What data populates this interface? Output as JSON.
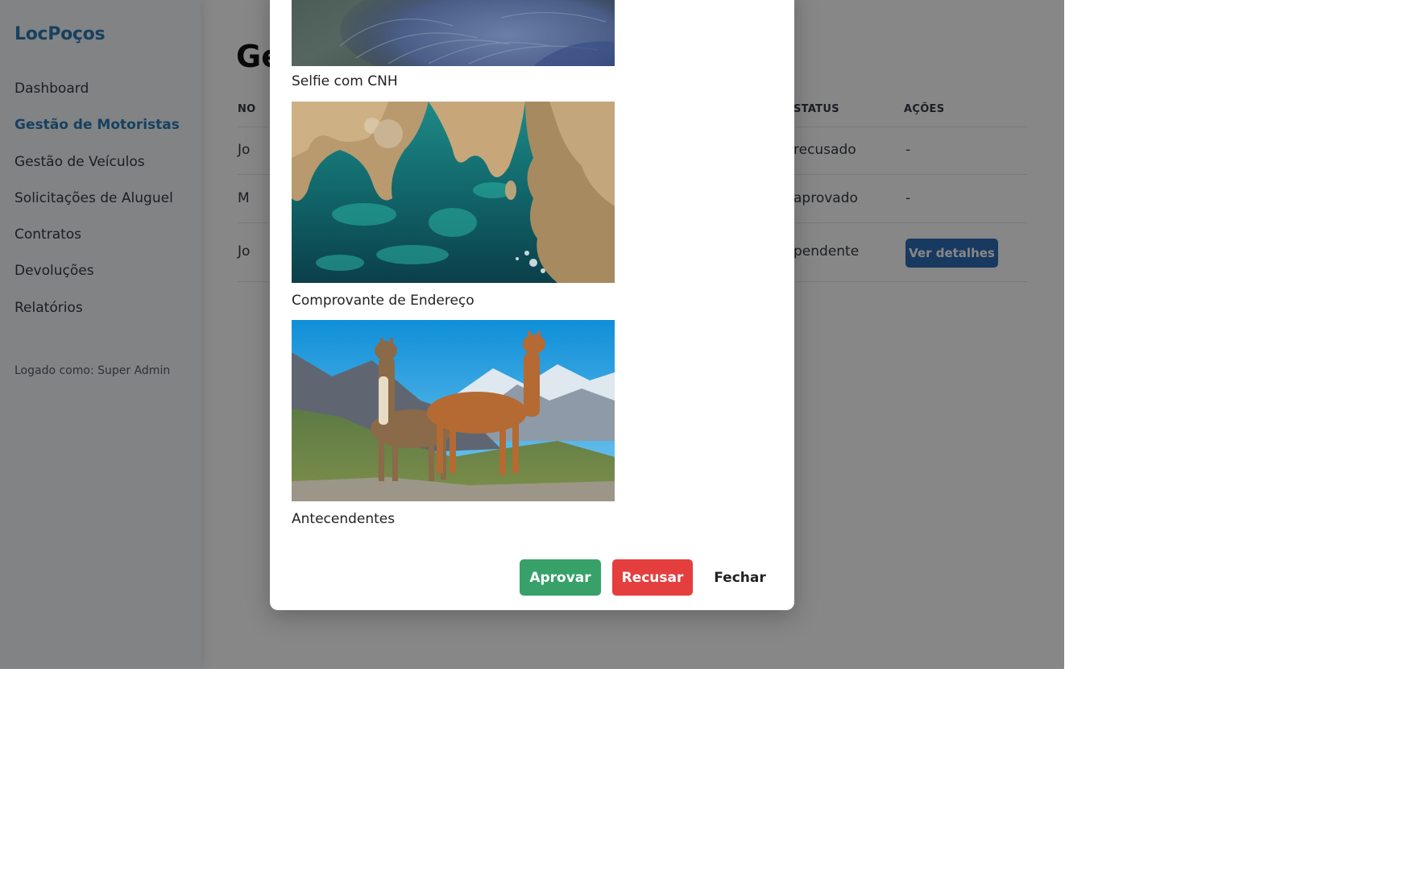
{
  "sidebar": {
    "brand": "LocPoços",
    "items": [
      {
        "label": "Dashboard"
      },
      {
        "label": "Gestão de Motoristas"
      },
      {
        "label": "Gestão de Veículos"
      },
      {
        "label": "Solicitações de Aluguel"
      },
      {
        "label": "Contratos"
      },
      {
        "label": "Devoluções"
      },
      {
        "label": "Relatórios"
      }
    ],
    "active_index": 1,
    "logged_in": "Logado como: Super Admin"
  },
  "main": {
    "title": "Ge",
    "table": {
      "headers": {
        "name": "NO",
        "status": "STATUS",
        "actions": "AÇÕES"
      },
      "rows": [
        {
          "name": "Jo",
          "status": "recusado",
          "action": "-"
        },
        {
          "name": "M",
          "status": "aprovado",
          "action": "-"
        },
        {
          "name": "Jo",
          "status": "pendente",
          "action": "Ver detalhes"
        }
      ]
    }
  },
  "modal": {
    "documents": [
      {
        "label": "Selfie com CNH",
        "image": "bird-feathers-photo"
      },
      {
        "label": "Comprovante de Endereço",
        "image": "aerial-coast-photo"
      },
      {
        "label": "Antecendentes",
        "image": "llamas-mountains-photo"
      }
    ],
    "buttons": {
      "approve": "Aprovar",
      "reject": "Recusar",
      "close": "Fechar"
    }
  },
  "colors": {
    "brand": "#2b7bb5",
    "approve": "#38a169",
    "reject": "#e53e3e",
    "details_button": "#2f6db5",
    "overlay": "rgba(0,0,0,0.47)"
  }
}
